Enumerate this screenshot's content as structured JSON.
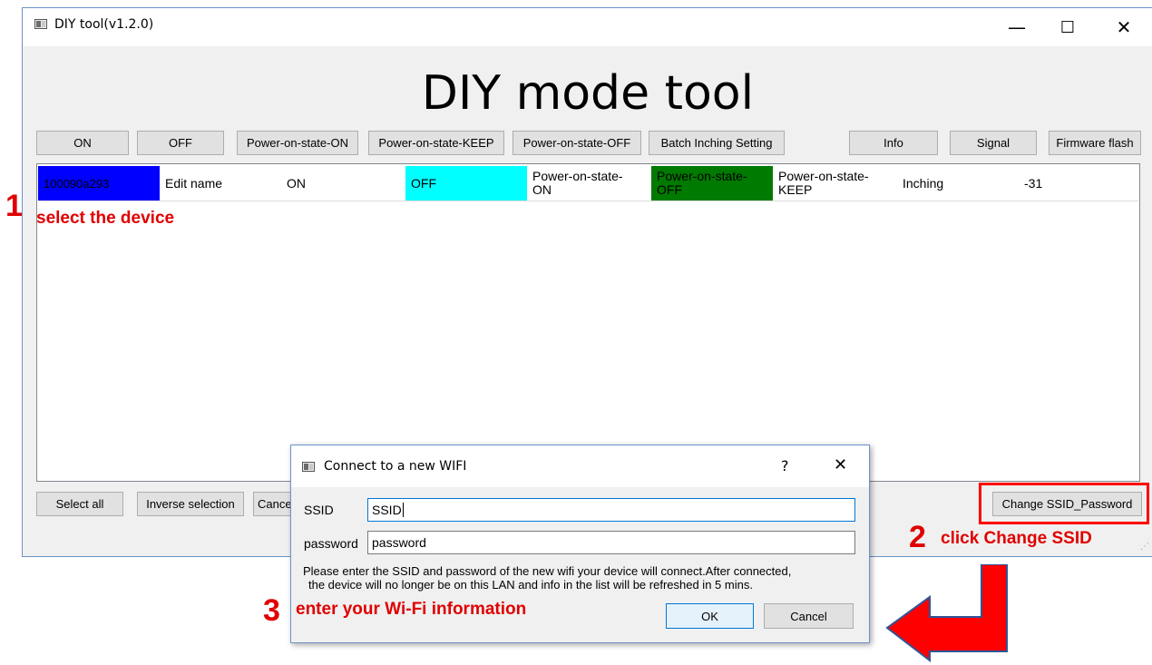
{
  "window": {
    "title": "DIY tool(v1.2.0)",
    "controls": {
      "minimize": "—",
      "maximize": "☐",
      "close": "✕"
    }
  },
  "header": {
    "title": "DIY mode tool"
  },
  "toolbar": {
    "on": "ON",
    "off": "OFF",
    "pos_on": "Power-on-state-ON",
    "pos_keep": "Power-on-state-KEEP",
    "pos_off": "Power-on-state-OFF",
    "batch_inching": "Batch Inching Setting",
    "info": "Info",
    "signal": "Signal",
    "firmware": "Firmware flash"
  },
  "device_row": {
    "id": "100090a293",
    "name": "Edit name",
    "on": "ON",
    "off": "OFF",
    "pos_on_1": "Power-on-state-",
    "pos_on_2": "ON",
    "pos_off_1": "Power-on-state-",
    "pos_off_2": "OFF",
    "pos_keep_1": "Power-on-state-",
    "pos_keep_2": "KEEP",
    "inching": "Inching",
    "signal": "-31"
  },
  "bottom_bar": {
    "select_all": "Select all",
    "inverse": "Inverse selection",
    "cancel_partial": "Cance",
    "change_ssid": "Change SSID_Password"
  },
  "dialog": {
    "title": "Connect to a new WIFI",
    "help": "?",
    "close": "✕",
    "ssid_label": "SSID",
    "ssid_value": "SSID",
    "password_label": "password",
    "password_value": "password",
    "message_1": "Please enter the SSID and password of the new wifi your device will connect.After connected,",
    "message_2": "the device will no longer be on this LAN and info in the list will be refreshed in 5 mins.",
    "ok": "OK",
    "cancel": "Cancel"
  },
  "annotations": {
    "step1_num": "1",
    "step1_text": "select the device",
    "step2_num": "2",
    "step2_text": "click Change SSID",
    "step3_num": "3",
    "step3_text": "enter your Wi-Fi information"
  },
  "colors": {
    "selected_id_bg": "#0000ff",
    "off_cell_bg": "#00ffff",
    "pos_off_cell_bg": "#007a00",
    "annotation_red": "#e00000",
    "arrow_fill": "#ff0000",
    "arrow_stroke": "#2f5597"
  },
  "icons": {
    "app": "app-window-icon",
    "arrow": "red-bent-arrow"
  }
}
